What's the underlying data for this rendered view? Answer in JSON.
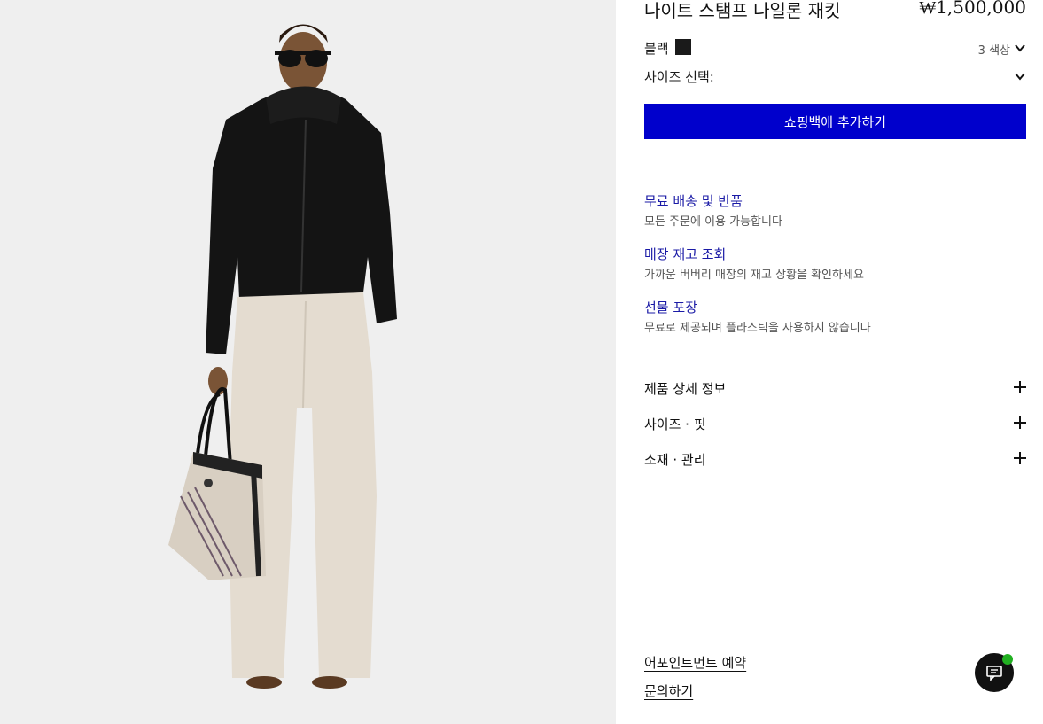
{
  "product": {
    "title": "나이트 스탬프 나일론 재킷",
    "price": "₩1,500,000",
    "color_label": "블랙",
    "color_swatch": "#1a1a1a",
    "color_count": "3 색상",
    "size_label": "사이즈 선택:",
    "add_to_bag_label": "쇼핑백에 추가하기"
  },
  "services": [
    {
      "title": "무료 배송 및 반품",
      "description": "모든 주문에 이용 가능합니다"
    },
    {
      "title": "매장 재고 조회",
      "description": "가까운 버버리 매장의 재고 상황을 확인하세요"
    },
    {
      "title": "선물 포장",
      "description": "무료로 제공되며 플라스틱을 사용하지 않습니다"
    }
  ],
  "accordion": [
    {
      "label": "제품 상세 정보"
    },
    {
      "label": "사이즈 · 핏"
    },
    {
      "label": "소재 · 관리"
    }
  ],
  "links": {
    "appointment": "어포인트먼트 예약",
    "inquiry": "문의하기"
  },
  "colors": {
    "accent_button": "#0000cc",
    "service_title": "#1a1aa6",
    "chat_badge": "#21b021"
  },
  "icons": {
    "chat": "chat-icon",
    "chevron": "chevron-down-icon",
    "expand": "plus-icon"
  }
}
